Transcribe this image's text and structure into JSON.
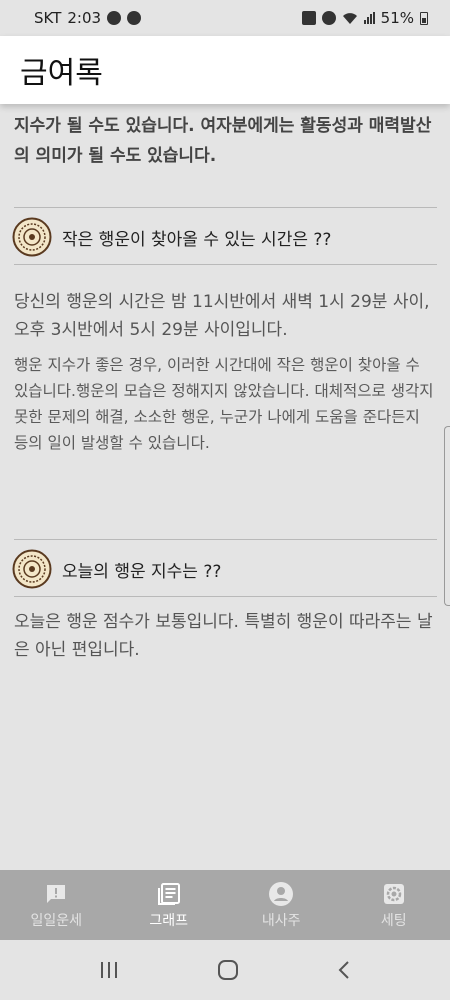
{
  "status_bar": {
    "carrier": "SKT",
    "time": "2:03",
    "battery": "51%"
  },
  "app_bar": {
    "title": "금여록"
  },
  "content": {
    "intro_text": "지수가 될 수도 있습니다. 여자분에게는 활동성과 매력발산의 의미가 될 수도 있습니다.",
    "sections": [
      {
        "title": "작은 행운이 찾아올 수 있는 시간은 ??",
        "para1": "당신의 행운의 시간은 밤 11시반에서 새벽 1시 29분 사이, 오후 3시반에서 5시 29분 사이입니다.",
        "para2": "행운 지수가 좋은 경우, 이러한 시간대에 작은 행운이 찾아올 수 있습니다.행운의 모습은 정해지지 않았습니다. 대체적으로 생각지 못한 문제의 해결, 소소한 행운, 누군가 나에게 도움을 준다든지 등의 일이 발생할 수 있습니다."
      },
      {
        "title": "오늘의 행운 지수는 ??",
        "para1": "오늘은 행운 점수가 보통입니다. 특별히 행운이 따라주는 날은 아닌 편입니다."
      }
    ]
  },
  "bottom_nav": {
    "items": [
      {
        "label": "일일운세",
        "icon": "alert-message-icon"
      },
      {
        "label": "그래프",
        "icon": "document-list-icon",
        "active": true
      },
      {
        "label": "내사주",
        "icon": "person-icon"
      },
      {
        "label": "세팅",
        "icon": "gear-icon"
      }
    ]
  },
  "system_nav": {
    "icons": [
      "recent-apps-icon",
      "home-icon",
      "back-icon"
    ]
  },
  "colors": {
    "background": "#e4e4e4",
    "app_bar": "#ffffff",
    "bottom_nav": "#a8a8a8",
    "divider": "#b9b9b9"
  }
}
